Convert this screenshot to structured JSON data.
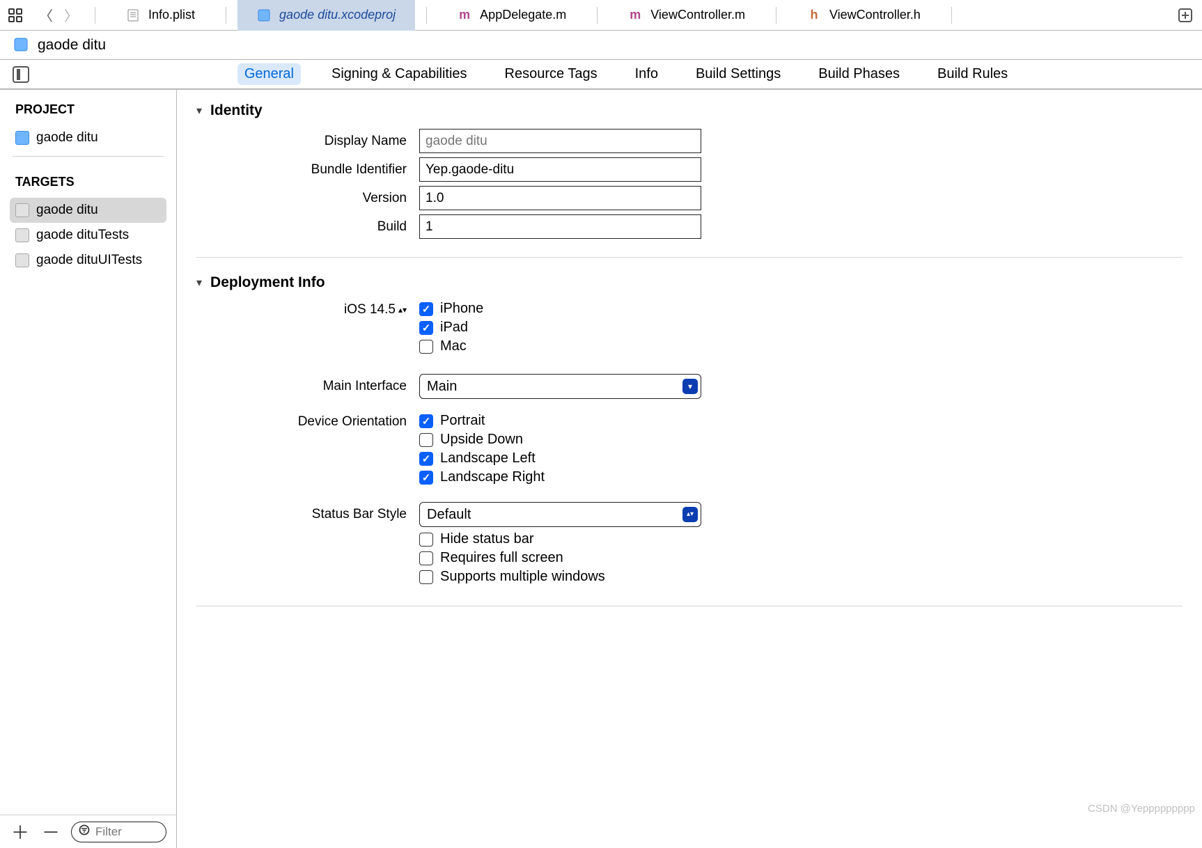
{
  "topbar": {
    "tabs": [
      {
        "icon": "plist-icon",
        "label": "Info.plist"
      },
      {
        "icon": "xcodeproj-icon",
        "label": "gaode ditu.xcodeproj",
        "active": true
      },
      {
        "icon": "m-icon",
        "label": "AppDelegate.m"
      },
      {
        "icon": "m-icon",
        "label": "ViewController.m"
      },
      {
        "icon": "h-icon",
        "label": "ViewController.h"
      }
    ]
  },
  "crumb": {
    "title": "gaode ditu"
  },
  "editor_tabs": [
    "General",
    "Signing & Capabilities",
    "Resource Tags",
    "Info",
    "Build Settings",
    "Build Phases",
    "Build Rules"
  ],
  "sidebar": {
    "project_header": "PROJECT",
    "project_items": [
      "gaode ditu"
    ],
    "targets_header": "TARGETS",
    "target_items": [
      "gaode ditu",
      "gaode dituTests",
      "gaode dituUITests"
    ],
    "filter_placeholder": "Filter"
  },
  "identity": {
    "title": "Identity",
    "display_name_label": "Display Name",
    "display_name_placeholder": "gaode ditu",
    "bundle_id_label": "Bundle Identifier",
    "bundle_id_value": "Yep.gaode-ditu",
    "version_label": "Version",
    "version_value": "1.0",
    "build_label": "Build",
    "build_value": "1"
  },
  "deployment": {
    "title": "Deployment Info",
    "ios_label": "iOS 14.5",
    "devices": [
      {
        "label": "iPhone",
        "checked": true
      },
      {
        "label": "iPad",
        "checked": true
      },
      {
        "label": "Mac",
        "checked": false
      }
    ],
    "main_interface_label": "Main Interface",
    "main_interface_value": "Main",
    "device_orientation_label": "Device Orientation",
    "orientations": [
      {
        "label": "Portrait",
        "checked": true
      },
      {
        "label": "Upside Down",
        "checked": false
      },
      {
        "label": "Landscape Left",
        "checked": true
      },
      {
        "label": "Landscape Right",
        "checked": true
      }
    ],
    "status_bar_label": "Status Bar Style",
    "status_bar_value": "Default",
    "status_checks": [
      {
        "label": "Hide status bar",
        "checked": false
      },
      {
        "label": "Requires full screen",
        "checked": false
      },
      {
        "label": "Supports multiple windows",
        "checked": false
      }
    ]
  },
  "watermark": "CSDN @Yeppppppppp"
}
